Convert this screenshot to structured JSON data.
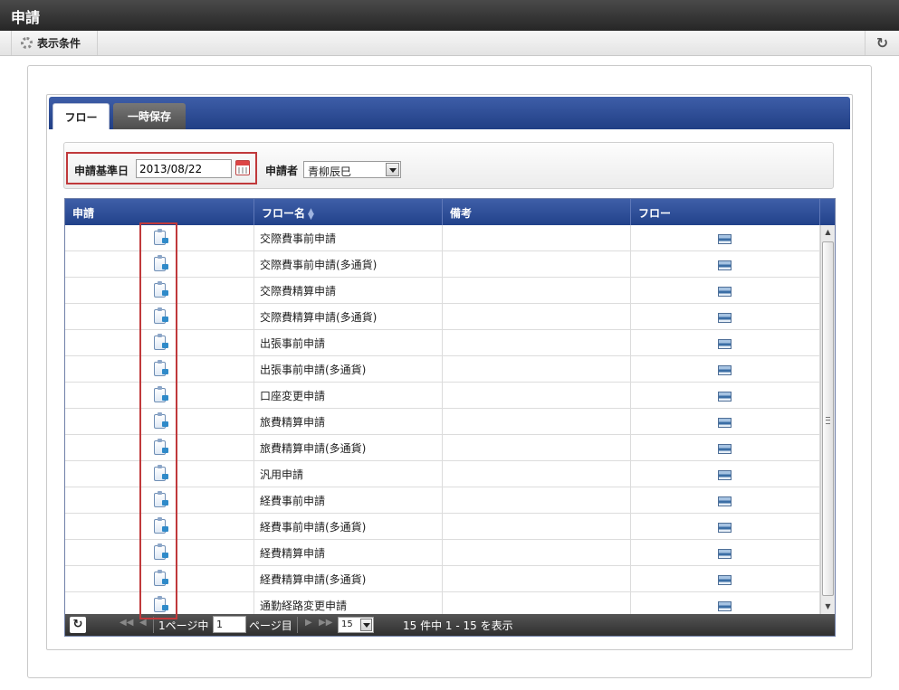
{
  "window": {
    "title": "申請"
  },
  "toolbar": {
    "conditions_label": "表示条件",
    "refresh_icon": "refresh-icon"
  },
  "tabs": [
    {
      "label": "フロー",
      "active": true
    },
    {
      "label": "一時保存",
      "active": false
    }
  ],
  "search": {
    "base_date_label": "申請基準日",
    "base_date_value": "2013/08/22",
    "applicant_label": "申請者",
    "applicant_value": "青柳辰巳"
  },
  "grid": {
    "columns": [
      "申請",
      "フロー名",
      "備考",
      "フロー"
    ],
    "sorted_column": "フロー名",
    "rows": [
      {
        "flow_name": "交際費事前申請",
        "note": ""
      },
      {
        "flow_name": "交際費事前申請(多通貨)",
        "note": ""
      },
      {
        "flow_name": "交際費精算申請",
        "note": ""
      },
      {
        "flow_name": "交際費精算申請(多通貨)",
        "note": ""
      },
      {
        "flow_name": "出張事前申請",
        "note": ""
      },
      {
        "flow_name": "出張事前申請(多通貨)",
        "note": ""
      },
      {
        "flow_name": "口座変更申請",
        "note": ""
      },
      {
        "flow_name": "旅費精算申請",
        "note": ""
      },
      {
        "flow_name": "旅費精算申請(多通貨)",
        "note": ""
      },
      {
        "flow_name": "汎用申請",
        "note": ""
      },
      {
        "flow_name": "経費事前申請",
        "note": ""
      },
      {
        "flow_name": "経費事前申請(多通貨)",
        "note": ""
      },
      {
        "flow_name": "経費精算申請",
        "note": ""
      },
      {
        "flow_name": "経費精算申請(多通貨)",
        "note": ""
      },
      {
        "flow_name": "通勤経路変更申請",
        "note": ""
      }
    ]
  },
  "pager": {
    "page_prefix": "1ページ中",
    "page_value": "1",
    "page_suffix": "ページ目",
    "per_page": "15",
    "summary": "15 件中 1 - 15 を表示"
  },
  "colors": {
    "header_blue": "#22428a",
    "highlight_red": "#c0393b"
  }
}
